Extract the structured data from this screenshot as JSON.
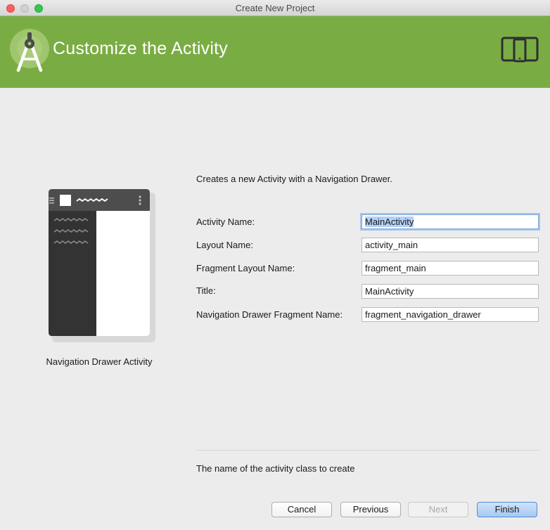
{
  "window": {
    "title": "Create New Project"
  },
  "header": {
    "title": "Customize the Activity"
  },
  "colors": {
    "header_green": "#7aac44",
    "drawer_dark": "#333333",
    "accent_blue": "#4f8ed8"
  },
  "template": {
    "caption": "Navigation Drawer Activity"
  },
  "form": {
    "description": "Creates a new Activity with a Navigation Drawer.",
    "fields": [
      {
        "label": "Activity Name:",
        "value": "MainActivity"
      },
      {
        "label": "Layout Name:",
        "value": "activity_main"
      },
      {
        "label": "Fragment Layout Name:",
        "value": "fragment_main"
      },
      {
        "label": "Title:",
        "value": "MainActivity"
      },
      {
        "label": "Navigation Drawer Fragment Name:",
        "value": "fragment_navigation_drawer"
      }
    ],
    "hint": "The name of the activity class to create"
  },
  "buttons": {
    "cancel": "Cancel",
    "previous": "Previous",
    "next": "Next",
    "finish": "Finish"
  },
  "icons": [
    "android-studio-logo-icon",
    "tablet-phone-device-icon",
    "hamburger-menu-icon",
    "overflow-menu-icon"
  ]
}
